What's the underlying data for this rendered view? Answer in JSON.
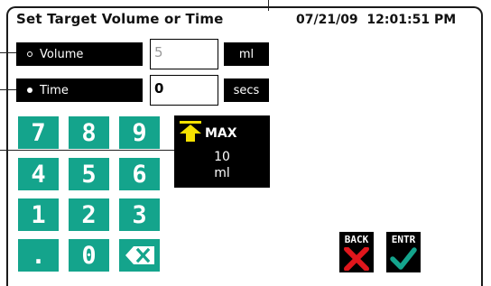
{
  "header": {
    "title": "Set Target Volume or Time",
    "datetime": "07/21/09  12:01:51 PM"
  },
  "volume_row": {
    "label": "Volume",
    "value": "5",
    "unit": "ml",
    "selected": false
  },
  "time_row": {
    "label": "Time",
    "value": "0",
    "unit": "secs",
    "selected": true
  },
  "keypad": {
    "keys": [
      "7",
      "8",
      "9",
      "4",
      "5",
      "6",
      "1",
      "2",
      "3",
      ".",
      "0"
    ],
    "backspace_icon": "backspace-icon"
  },
  "max_panel": {
    "label": "MAX",
    "value": "10",
    "unit": "ml",
    "icon": "arrow-up-to-max-icon"
  },
  "actions": {
    "back_label": "BACK",
    "enter_label": "ENTR"
  },
  "colors": {
    "keypad_teal": "#14a48c",
    "arrow_yellow": "#f5e100",
    "back_red": "#e0161c",
    "enter_teal": "#14a48c"
  }
}
